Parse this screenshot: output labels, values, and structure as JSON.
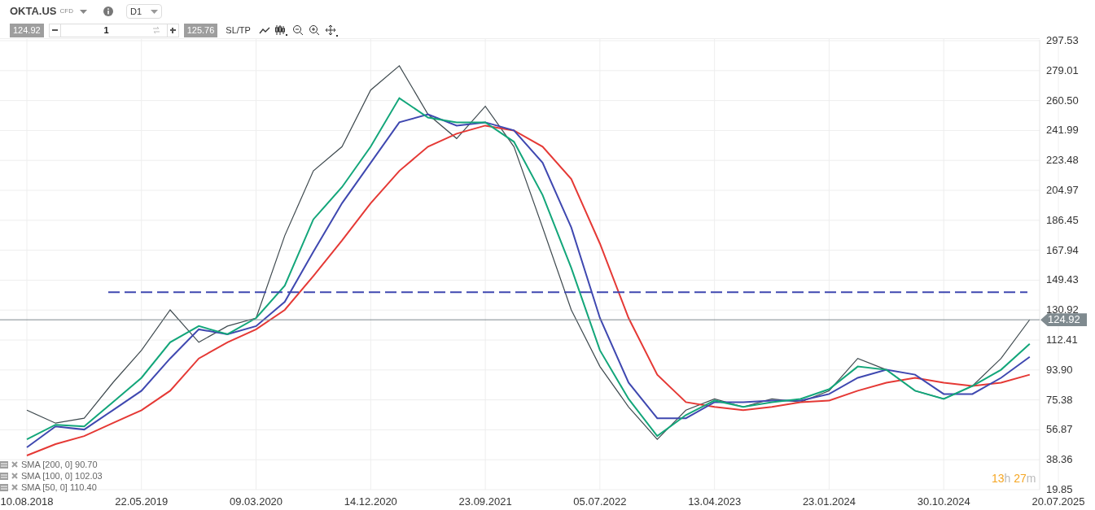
{
  "toolbar": {
    "symbol": "OKTA.US",
    "instrument_type": "CFD",
    "timeframe": "D1",
    "bid": "124.92",
    "quantity": "1",
    "ask": "125.76",
    "sl_tp": "SL/TP"
  },
  "chart": {
    "chart_data": {
      "type": "line",
      "grid": true,
      "categories": [
        "10.08.2018",
        null,
        null,
        null,
        "22.05.2019",
        null,
        null,
        null,
        "09.03.2020",
        null,
        null,
        null,
        "14.12.2020",
        null,
        null,
        null,
        "23.09.2021",
        null,
        null,
        null,
        "05.07.2022",
        null,
        null,
        null,
        "13.04.2023",
        null,
        null,
        null,
        "23.01.2024",
        null,
        null,
        null,
        "30.10.2024",
        null,
        null,
        null,
        "20.07.2025"
      ],
      "yticks": [
        {
          "value": 19.85,
          "label": "19.85"
        },
        {
          "value": 38.36,
          "label": "38.36"
        },
        {
          "value": 56.87,
          "label": "56.87"
        },
        {
          "value": 75.38,
          "label": "75.38"
        },
        {
          "value": 93.9,
          "label": "93.90"
        },
        {
          "value": 112.41,
          "label": "112.41"
        },
        {
          "value": 130.92,
          "label": "130.92"
        },
        {
          "value": 149.43,
          "label": "149.43"
        },
        {
          "value": 167.94,
          "label": "167.94"
        },
        {
          "value": 186.45,
          "label": "186.45"
        },
        {
          "value": 204.97,
          "label": "204.97"
        },
        {
          "value": 223.48,
          "label": "223.48"
        },
        {
          "value": 241.99,
          "label": "241.99"
        },
        {
          "value": 260.5,
          "label": "260.50"
        },
        {
          "value": 279.01,
          "label": "279.01"
        },
        {
          "value": 297.53,
          "label": "297.53"
        }
      ],
      "ylim": [
        19.85,
        297.53
      ],
      "ref_lines": [
        {
          "axis": "y",
          "value": 142,
          "color": "#3f48b0"
        },
        {
          "axis": "y",
          "value": 124.92,
          "label": "124.92",
          "color": "#7f8a8f"
        }
      ],
      "series": [
        {
          "color": "#3f4a4f",
          "values": [
            69,
            61,
            64,
            86,
            106,
            131,
            111,
            121,
            126,
            177,
            217,
            232,
            267,
            282,
            252,
            237,
            257,
            232,
            182,
            131,
            96,
            71,
            51,
            69,
            76,
            71,
            76,
            74,
            81,
            101,
            94,
            81,
            76,
            84,
            101,
            125,
            null
          ]
        },
        {
          "name": "SMA [200, 0]",
          "color": "#e53935",
          "values": [
            41,
            48,
            53,
            61,
            69,
            81,
            101,
            111,
            119,
            131,
            152,
            174,
            197,
            217,
            232,
            240,
            245,
            242,
            232,
            212,
            172,
            126,
            91,
            74,
            71,
            69,
            71,
            74,
            75,
            81,
            86,
            89,
            86,
            84,
            86,
            91,
            null
          ]
        },
        {
          "name": "SMA [100, 0]",
          "color": "#3f48b0",
          "values": [
            46,
            59,
            57,
            69,
            81,
            101,
            119,
            116,
            121,
            136,
            167,
            197,
            222,
            247,
            252,
            245,
            247,
            242,
            222,
            182,
            126,
            86,
            64,
            64,
            74,
            74,
            75,
            75,
            79,
            89,
            94,
            91,
            79,
            79,
            89,
            102,
            null
          ]
        },
        {
          "name": "SMA [50, 0]",
          "color": "#13a67a",
          "values": [
            51,
            60,
            59,
            74,
            89,
            111,
            121,
            116,
            126,
            146,
            187,
            207,
            232,
            262,
            250,
            247,
            247,
            235,
            202,
            157,
            106,
            76,
            53,
            66,
            75,
            71,
            74,
            76,
            82,
            96,
            94,
            81,
            76,
            84,
            94,
            110,
            null
          ]
        }
      ]
    },
    "legend": [
      {
        "value": "90.70"
      },
      {
        "value": "102.03"
      },
      {
        "value": "110.40"
      }
    ],
    "timer": {
      "hours": "13",
      "hours_unit": "h",
      "minutes": "27",
      "minutes_unit": "m"
    }
  }
}
